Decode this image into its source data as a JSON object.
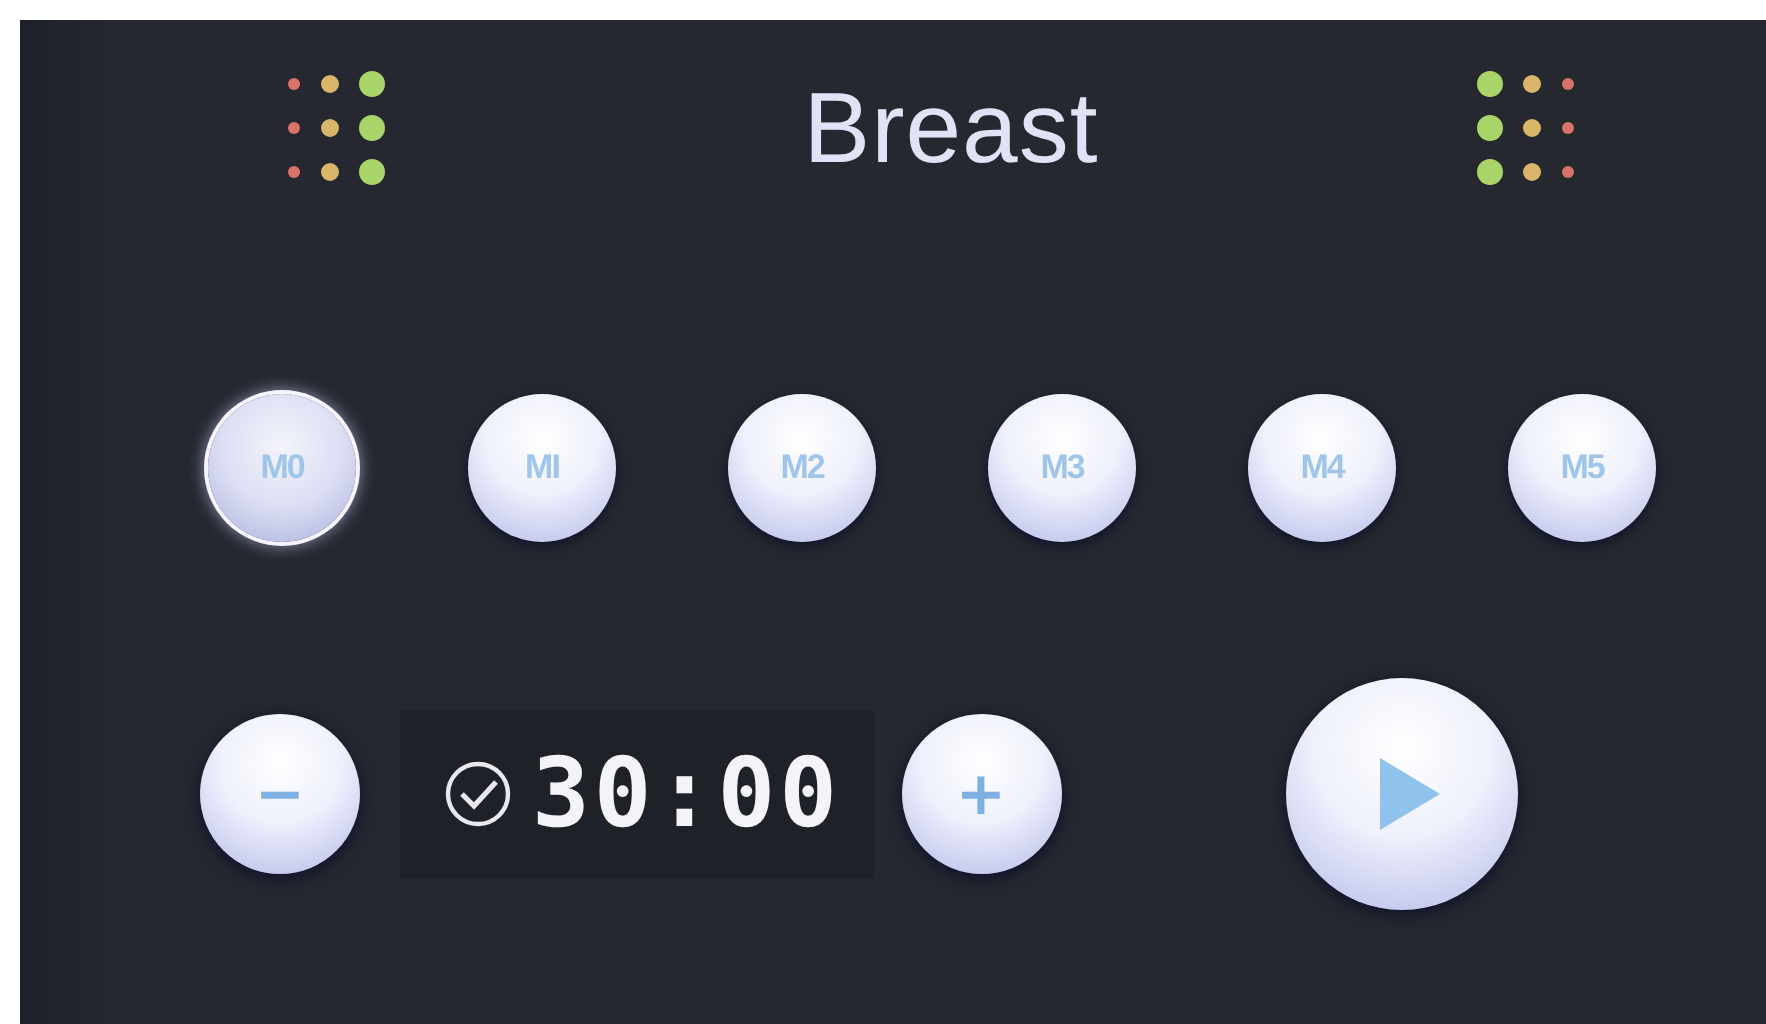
{
  "title": "Breast",
  "modes": [
    {
      "label": "M0",
      "selected": true
    },
    {
      "label": "MI",
      "selected": false
    },
    {
      "label": "M2",
      "selected": false
    },
    {
      "label": "M3",
      "selected": false
    },
    {
      "label": "M4",
      "selected": false
    },
    {
      "label": "M5",
      "selected": false
    }
  ],
  "timer": {
    "decrease": "−",
    "time": "30:00",
    "increase": "+"
  }
}
